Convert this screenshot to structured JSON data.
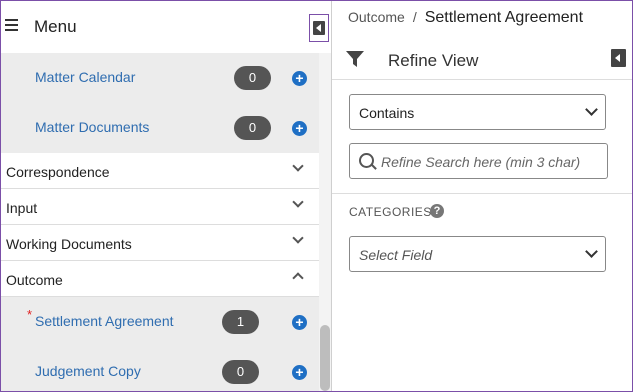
{
  "menu": {
    "title": "Menu",
    "top_items": [
      {
        "label": "Matter Calendar",
        "count": "0",
        "add": "+"
      },
      {
        "label": "Matter Documents",
        "count": "0",
        "add": "+"
      }
    ],
    "sections": [
      {
        "label": "Correspondence",
        "expanded": false
      },
      {
        "label": "Input",
        "expanded": false
      },
      {
        "label": "Working Documents",
        "expanded": false
      },
      {
        "label": "Outcome",
        "expanded": true
      }
    ],
    "outcome_items": [
      {
        "label": "Settlement Agreement",
        "count": "1",
        "required": "*",
        "add": "+"
      },
      {
        "label": "Judgement Copy",
        "count": "0",
        "add": "+"
      }
    ]
  },
  "breadcrumb": {
    "parent": "Outcome",
    "separator": "/",
    "current": "Settlement Agreement"
  },
  "refine": {
    "title": "Refine View",
    "match_mode": "Contains",
    "search_placeholder": "Refine Search here (min 3 char)",
    "categories_label": "CATEGORIES",
    "help": "?",
    "field_placeholder": "Select Field"
  },
  "colors": {
    "link": "#2f6db0",
    "accent_border": "#7b4fa8",
    "badge": "#555555",
    "add_icon": "#1f6fc4",
    "required": "#e02020"
  }
}
